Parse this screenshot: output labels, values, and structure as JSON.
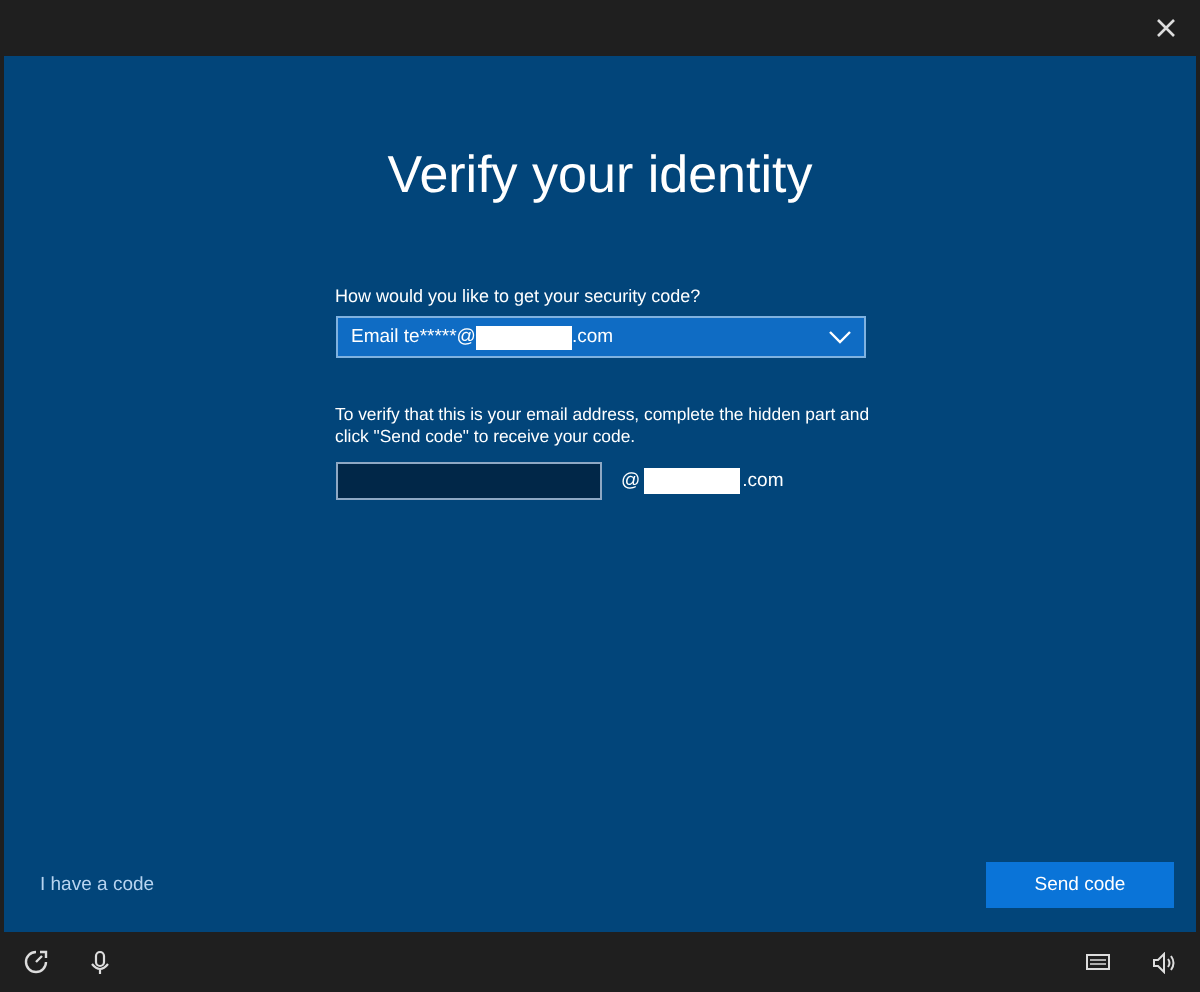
{
  "dialog": {
    "title": "Verify your identity",
    "method_label": "How would you like to get your security code?",
    "method_dropdown": {
      "value_prefix": "Email te*****@",
      "value_suffix": ".com"
    },
    "instruction": "To verify that this is your email address, complete the hidden part and click \"Send code\" to receive your code.",
    "email_field": {
      "at": "@",
      "suffix": ".com"
    },
    "link": "I have a code",
    "button": "Send code"
  }
}
